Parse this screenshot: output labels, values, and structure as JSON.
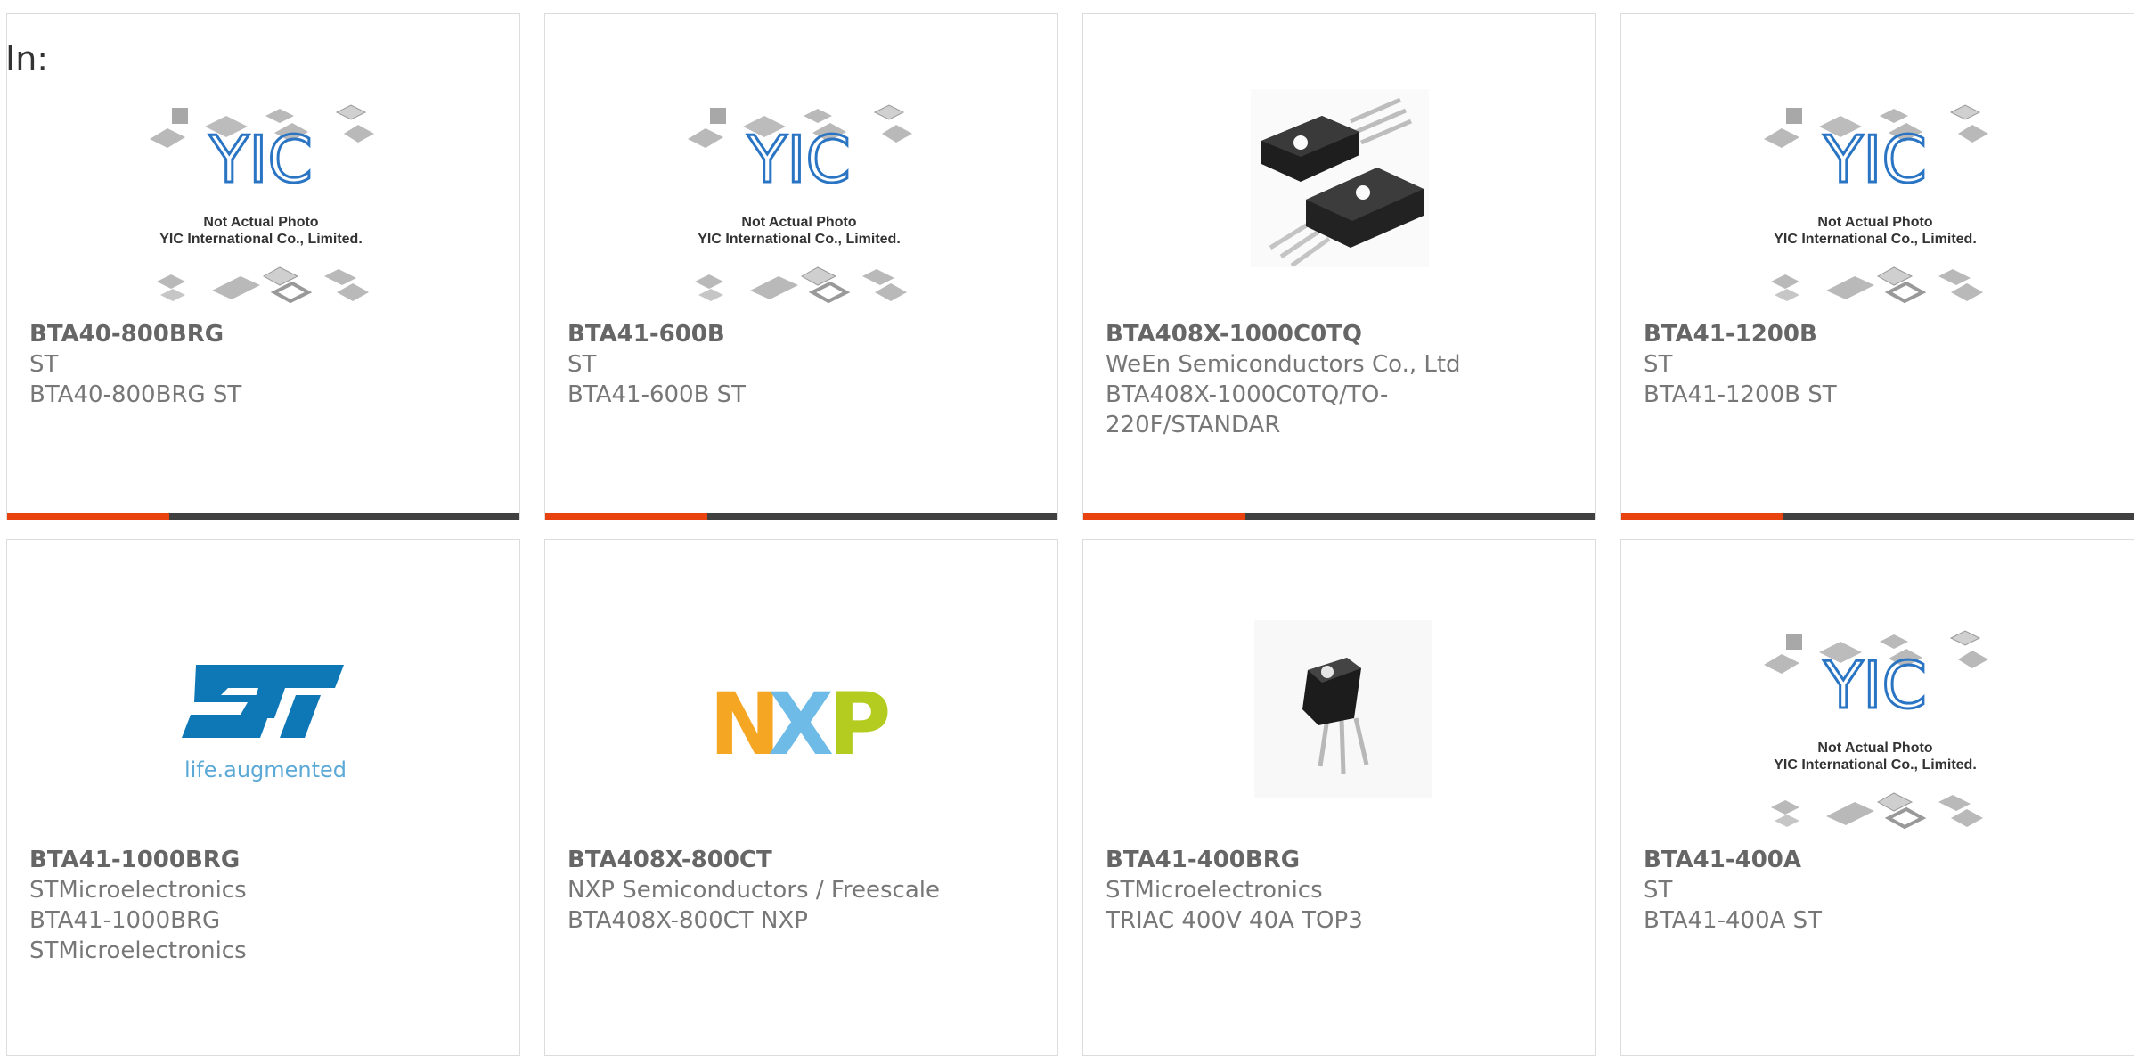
{
  "label": "In:",
  "placeholder": {
    "logo": "YIC",
    "line1": "Not Actual Photo",
    "line2": "YIC International Co., Limited."
  },
  "logos": {
    "st_tagline": "life.augmented",
    "nxp": [
      "N",
      "X",
      "P"
    ]
  },
  "colors": {
    "accent_orange": "#e8430f",
    "bar_dark": "#404040",
    "yic_blue": "#2a74c4",
    "st_blue": "#0e78b6",
    "nxp_orange": "#f5a623",
    "nxp_blue": "#6dbbe6",
    "nxp_green": "#b3cc1f"
  },
  "cards": [
    {
      "part": "BTA40-800BRG",
      "lines": [
        "ST",
        "BTA40-800BRG ST"
      ],
      "image": "placeholder"
    },
    {
      "part": "BTA41-600B",
      "lines": [
        "ST",
        "BTA41-600B ST"
      ],
      "image": "placeholder"
    },
    {
      "part": "BTA408X-1000C0TQ",
      "lines": [
        "WeEn Semiconductors Co., Ltd",
        "BTA408X-1000C0TQ/TO-",
        "220F/STANDAR"
      ],
      "image": "to220-pair"
    },
    {
      "part": "BTA41-1200B",
      "lines": [
        "ST",
        "BTA41-1200B ST"
      ],
      "image": "placeholder"
    },
    {
      "part": "BTA41-1000BRG",
      "lines": [
        "STMicroelectronics",
        "BTA41-1000BRG",
        "STMicroelectronics"
      ],
      "image": "st-logo"
    },
    {
      "part": "BTA408X-800CT",
      "lines": [
        "NXP Semiconductors / Freescale",
        "BTA408X-800CT NXP"
      ],
      "image": "nxp-logo"
    },
    {
      "part": "BTA41-400BRG",
      "lines": [
        "STMicroelectronics",
        "TRIAC 400V 40A TOP3"
      ],
      "image": "top3"
    },
    {
      "part": "BTA41-400A",
      "lines": [
        "ST",
        "BTA41-400A ST"
      ],
      "image": "placeholder"
    }
  ]
}
